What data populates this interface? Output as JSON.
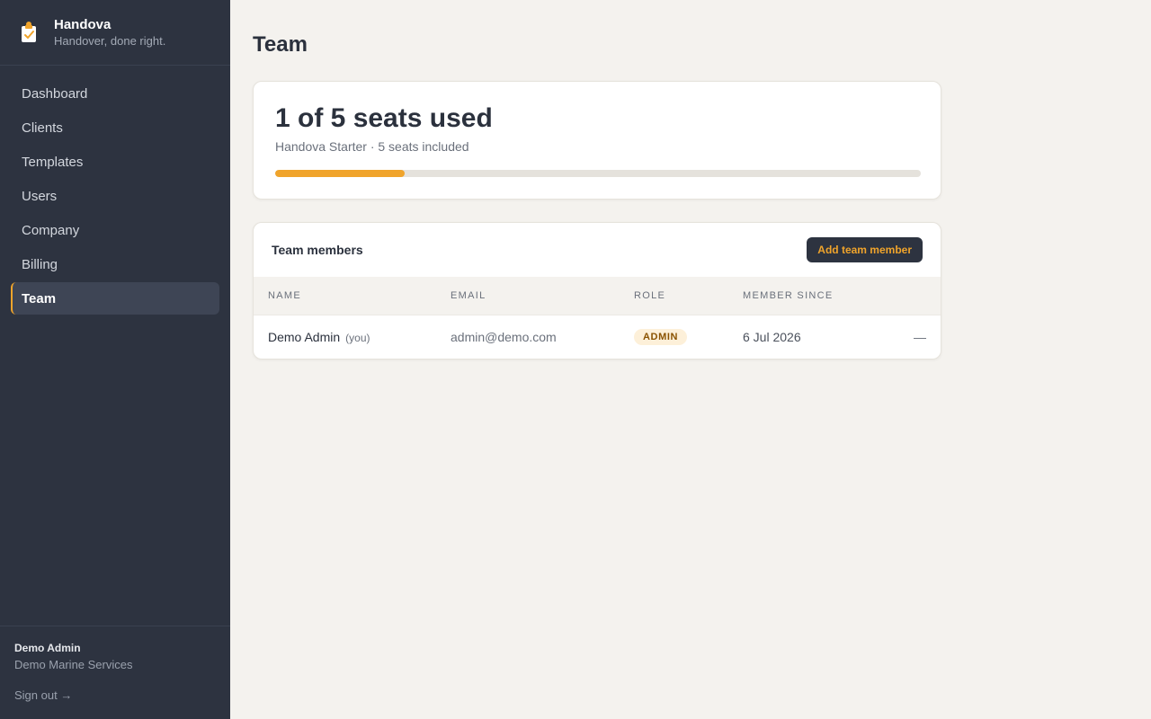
{
  "brand": {
    "name": "Handova",
    "tagline": "Handover, done right."
  },
  "nav": {
    "items": [
      {
        "label": "Dashboard"
      },
      {
        "label": "Clients"
      },
      {
        "label": "Templates"
      },
      {
        "label": "Users"
      },
      {
        "label": "Company"
      },
      {
        "label": "Billing"
      },
      {
        "label": "Team",
        "active": true
      }
    ]
  },
  "footer": {
    "user_name": "Demo Admin",
    "company_name": "Demo Marine Services",
    "signout_label": "Sign out →"
  },
  "page": {
    "title": "Team"
  },
  "seats": {
    "headline": "1 of 5 seats used",
    "plan_text": "Handova Starter · 5 seats included",
    "used": 1,
    "total": 5
  },
  "members": {
    "title": "Team members",
    "add_button_label": "Add team member",
    "columns": [
      "NAME",
      "EMAIL",
      "ROLE",
      "MEMBER SINCE"
    ],
    "rows": [
      {
        "name": "Demo Admin",
        "you_label": "(you)",
        "email": "admin@demo.com",
        "role": "ADMIN",
        "member_since": "6 Jul 2026",
        "action": "—"
      }
    ]
  },
  "colors": {
    "accent": "#f0a42b",
    "sidebar_bg": "#2d3340",
    "page_bg": "#f4f2ee"
  },
  "icons": {
    "brand_logo": "clipboard-check-icon"
  }
}
